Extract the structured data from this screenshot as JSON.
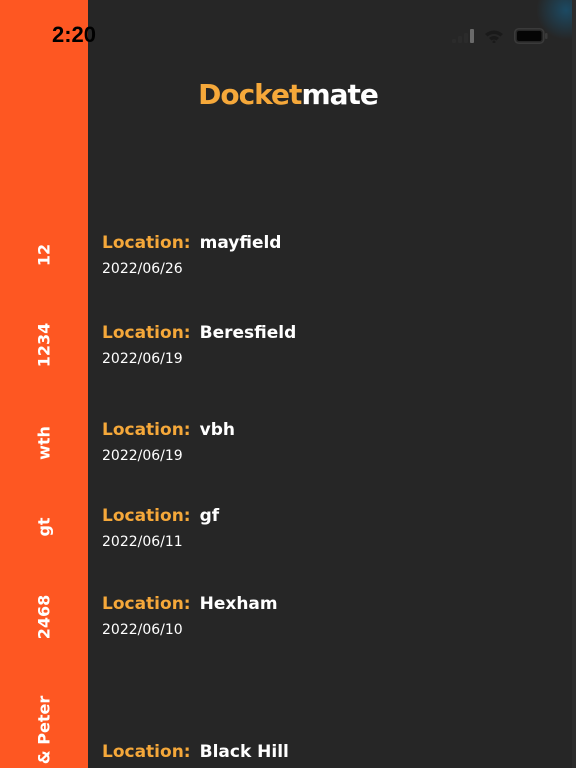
{
  "status_bar": {
    "time": "2:20",
    "icons": [
      "signal-icon",
      "wifi-icon",
      "battery-icon"
    ]
  },
  "app": {
    "title_part1": "Docket",
    "title_part2": "mate"
  },
  "colors": {
    "accent_orange": "#fe5722",
    "title_orange": "#f5a83a",
    "background": "#262626",
    "text": "#ffffff"
  },
  "entries": [
    {
      "strip_label": "12",
      "location_label": "Location:",
      "location": "mayfield",
      "date": "2022/06/26"
    },
    {
      "strip_label": "1234",
      "location_label": "Location:",
      "location": "Beresfield",
      "date": "2022/06/19"
    },
    {
      "strip_label": "wth",
      "location_label": "Location:",
      "location": "vbh",
      "date": "2022/06/19"
    },
    {
      "strip_label": "gt",
      "location_label": "Location:",
      "location": "gf",
      "date": "2022/06/11"
    },
    {
      "strip_label": "2468",
      "location_label": "Location:",
      "location": "Hexham",
      "date": "2022/06/10"
    },
    {
      "strip_label": "& Peter",
      "location_label": "Location:",
      "location": "Black Hill",
      "date": ""
    }
  ]
}
